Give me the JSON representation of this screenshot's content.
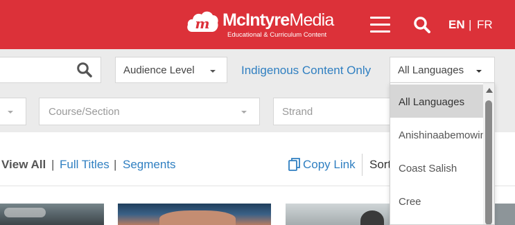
{
  "colors": {
    "brand_red": "#dc3139",
    "link_blue": "#2f7fc1",
    "filter_bg": "#ebebeb"
  },
  "header": {
    "logo": {
      "name_bold": "McIntyre",
      "name_regular": "Media",
      "tagline": "Educational & Curriculum Content",
      "mark_letter": "m"
    },
    "menu_icon": "hamburger-icon",
    "search_icon": "search-icon",
    "lang_en": "EN",
    "lang_separator": "|",
    "lang_fr": "FR"
  },
  "filters": {
    "search": {
      "placeholder": "",
      "icon": "search-icon"
    },
    "audience_level": "Audience Level",
    "indigenous_link": "Indigenous Content Only",
    "languages": {
      "selected": "All Languages",
      "options": [
        "All Languages",
        "Anishinaabemowin",
        "Coast Salish",
        "Cree"
      ]
    },
    "course_section": "Course/Section",
    "strand": "Strand"
  },
  "view": {
    "view_all": "View All",
    "separator": "|",
    "full_titles": "Full Titles",
    "segments": "Segments",
    "copy_icon": "copy-icon",
    "copy_link": "Copy Link",
    "sort": "Sort"
  }
}
